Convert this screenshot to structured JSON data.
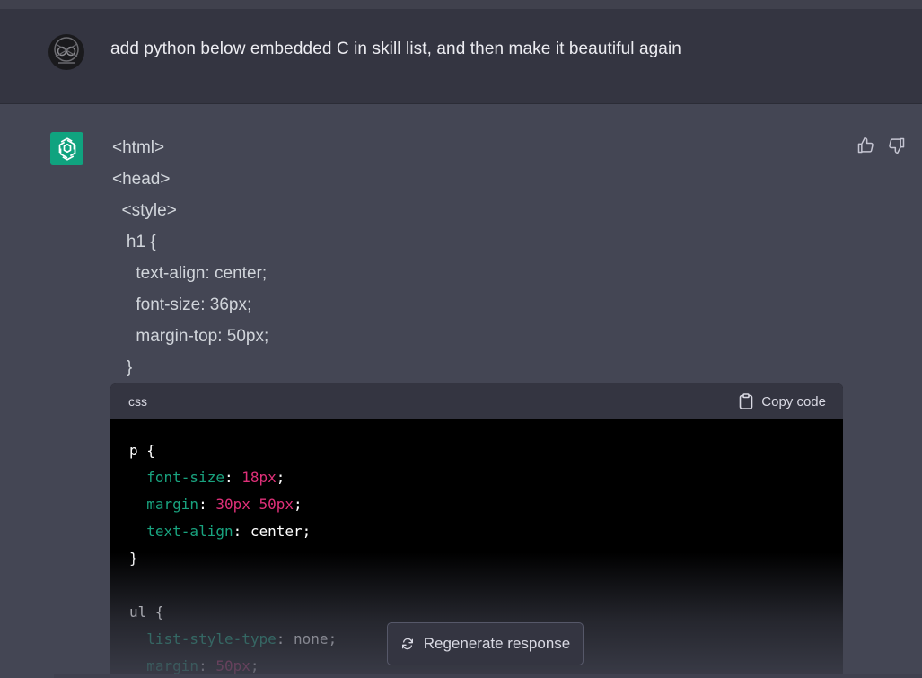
{
  "user": {
    "message": "add python below embedded C in skill list, and then make it beautiful again"
  },
  "assistant": {
    "html_lines": [
      "<html>",
      "<head>",
      "  <style>",
      "   h1 {",
      "     text-align: center;",
      "     font-size: 36px;",
      "     margin-top: 50px;",
      "   }"
    ],
    "code_block": {
      "language": "css",
      "copy_label": "Copy code",
      "lines": [
        [
          {
            "t": "p {",
            "k": "plain"
          }
        ],
        [
          {
            "t": "  font-size",
            "k": "prop"
          },
          {
            "t": ": ",
            "k": "plain"
          },
          {
            "t": "18px",
            "k": "num"
          },
          {
            "t": ";",
            "k": "plain"
          }
        ],
        [
          {
            "t": "  margin",
            "k": "prop"
          },
          {
            "t": ": ",
            "k": "plain"
          },
          {
            "t": "30px 50px",
            "k": "num"
          },
          {
            "t": ";",
            "k": "plain"
          }
        ],
        [
          {
            "t": "  text-align",
            "k": "prop"
          },
          {
            "t": ": center;",
            "k": "plain"
          }
        ],
        [
          {
            "t": "}",
            "k": "plain"
          }
        ],
        [
          {
            "t": "",
            "k": "plain"
          }
        ],
        [
          {
            "t": "ul {",
            "k": "plain"
          }
        ],
        [
          {
            "t": "  list-style-type",
            "k": "prop"
          },
          {
            "t": ": none;",
            "k": "plain"
          }
        ],
        [
          {
            "t": "  margin",
            "k": "prop"
          },
          {
            "t": ": ",
            "k": "plain"
          },
          {
            "t": "50px",
            "k": "num"
          },
          {
            "t": ";",
            "k": "plain"
          }
        ]
      ]
    }
  },
  "regenerate": {
    "label": "Regenerate response"
  },
  "colors": {
    "accent": "#10a37f",
    "property": "#19a37f",
    "number": "#df3079"
  },
  "icons": {
    "user_avatar": "user-avatar-logo",
    "assistant_avatar": "openai-logo-icon",
    "thumbs_up": "thumbs-up-icon",
    "thumbs_down": "thumbs-down-icon",
    "copy": "clipboard-icon",
    "regenerate": "refresh-icon"
  }
}
